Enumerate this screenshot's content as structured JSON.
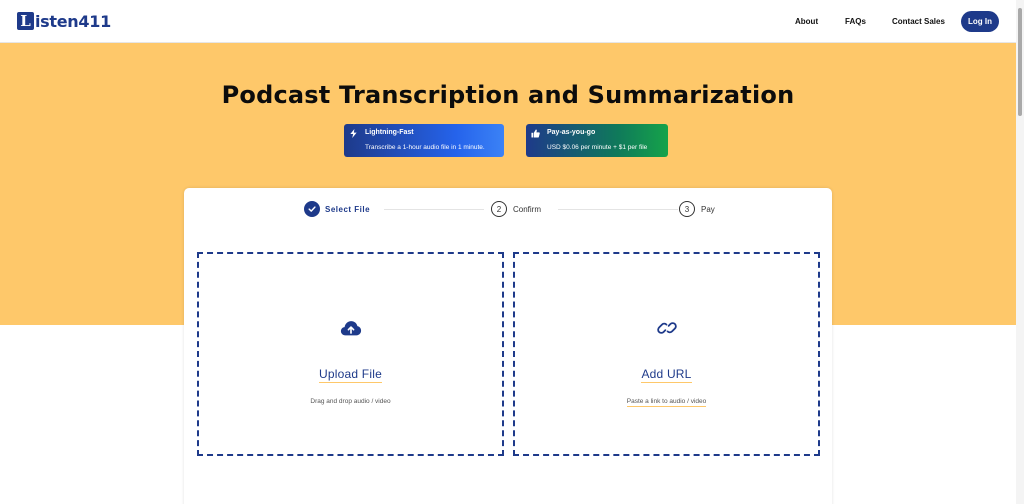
{
  "brand": {
    "logo_letter": "L",
    "name": "isten411",
    "brand_color": "#1e3a8a"
  },
  "nav": {
    "about": "About",
    "faqs": "FAQs",
    "contact_sales": "Contact Sales",
    "login": "Log In"
  },
  "hero": {
    "title": "Podcast Transcription and Summarization",
    "background": "#fec86a",
    "badges": [
      {
        "icon": "lightning-icon",
        "title": "Lightning-Fast",
        "subtitle": "Transcribe a 1-hour audio file in 1 minute."
      },
      {
        "icon": "thumbs-up-icon",
        "title": "Pay-as-you-go",
        "subtitle": "USD $0.06 per minute + $1 per file"
      }
    ]
  },
  "stepper": {
    "steps": [
      {
        "number": "1",
        "label": "Select File",
        "state": "active"
      },
      {
        "number": "2",
        "label": "Confirm",
        "state": "pending"
      },
      {
        "number": "3",
        "label": "Pay",
        "state": "pending"
      }
    ]
  },
  "upload": {
    "icon": "cloud-upload-icon",
    "title": "Upload File",
    "subtitle": "Drag and drop audio / video"
  },
  "url": {
    "icon": "link-icon",
    "title": "Add URL",
    "subtitle": "Paste a link to audio / video"
  }
}
